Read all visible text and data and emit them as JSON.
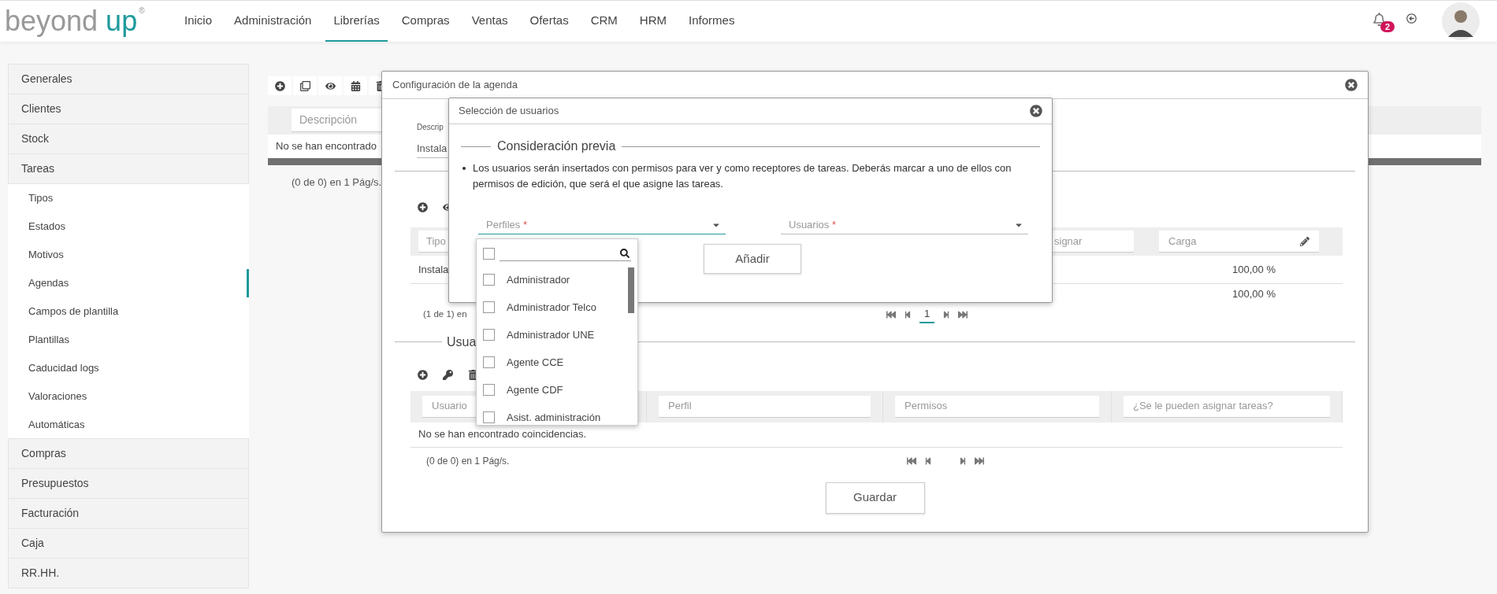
{
  "header": {
    "logo": {
      "word_1": "beyond",
      "word_2": "up",
      "mark": "®"
    },
    "nav": [
      {
        "label": "Inicio",
        "selected": false
      },
      {
        "label": "Administración",
        "selected": false
      },
      {
        "label": "Librerías",
        "selected": true
      },
      {
        "label": "Compras",
        "selected": false
      },
      {
        "label": "Ventas",
        "selected": false
      },
      {
        "label": "Ofertas",
        "selected": false
      },
      {
        "label": "CRM",
        "selected": false
      },
      {
        "label": "HRM",
        "selected": false
      },
      {
        "label": "Informes",
        "selected": false
      }
    ],
    "notifications": {
      "count": "2"
    }
  },
  "sidebar": {
    "items": [
      {
        "label": "Generales"
      },
      {
        "label": "Clientes"
      },
      {
        "label": "Stock"
      },
      {
        "label": "Tareas",
        "children": [
          {
            "label": "Tipos",
            "selected": false
          },
          {
            "label": "Estados",
            "selected": false
          },
          {
            "label": "Motivos",
            "selected": false
          },
          {
            "label": "Agendas",
            "selected": true
          },
          {
            "label": "Campos de plantilla",
            "selected": false
          },
          {
            "label": "Plantillas",
            "selected": false
          },
          {
            "label": "Caducidad logs",
            "selected": false
          },
          {
            "label": "Valoraciones",
            "selected": false
          },
          {
            "label": "Automáticas",
            "selected": false
          }
        ]
      },
      {
        "label": "Compras"
      },
      {
        "label": "Presupuestos"
      },
      {
        "label": "Facturación"
      },
      {
        "label": "Caja"
      },
      {
        "label": "RR.HH."
      }
    ]
  },
  "page_table": {
    "columns": [
      "Descripción"
    ],
    "empty_message": "No se han encontrado",
    "pager": "(0 de 0) en 1 Pág/s."
  },
  "agenda_dialog": {
    "title": "Configuración de la agenda",
    "form": {
      "label": "Descrip",
      "value": "Instala"
    },
    "tasks_table": {
      "columns": [
        "Tipo",
        "signar",
        "Carga"
      ],
      "rows": [
        {
          "column_1": "Instala",
          "load": "100,00 %"
        }
      ],
      "total": "100,00 %",
      "pager": "(1 de 1) en",
      "pages": [
        {
          "label": "1",
          "selected": true
        }
      ]
    },
    "users_section": {
      "title": "Usua",
      "columns": [
        "Usuario",
        "Perfil",
        "Permisos",
        "¿Se le pueden asignar tareas?"
      ],
      "empty_message": "No se han encontrado coincidencias.",
      "pager": "(0 de 0) en 1 Pág/s."
    },
    "save_button": "Guardar"
  },
  "users_dialog": {
    "title": "Selección de usuarios",
    "section_title": "Consideración previa",
    "note": "Los usuarios serán insertados con permisos para ver y como receptores de tareas. Deberás marcar a uno de ellos con permisos de edición, que será el que asigne las tareas.",
    "fields": [
      {
        "placeholder": "Perfiles",
        "required_mark": "*",
        "expanded": true
      },
      {
        "placeholder": "Usuarios",
        "required_mark": "*",
        "expanded": false
      }
    ],
    "add_button": "Añadir",
    "dropdown": {
      "select_all_checked": false,
      "options": [
        {
          "label": "Administrador",
          "checked": false
        },
        {
          "label": "Administrador Telco",
          "checked": false
        },
        {
          "label": "Administrador UNE",
          "checked": false
        },
        {
          "label": "Agente CCE",
          "checked": false
        },
        {
          "label": "Agente CDF",
          "checked": false
        },
        {
          "label": "Asist. administración",
          "checked": false
        }
      ]
    }
  }
}
